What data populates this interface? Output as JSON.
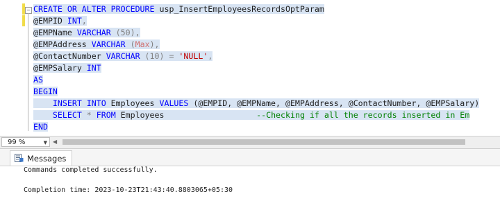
{
  "editor": {
    "lines": {
      "l1": [
        "CREATE OR ALTER PROCEDURE",
        " usp_InsertEmployeesRecordsOptParam"
      ],
      "l2": [
        "@EMPID ",
        "INT",
        ","
      ],
      "l3": [
        "@EMPName ",
        "VARCHAR",
        " (50),"
      ],
      "l4": [
        "@EMPAddress ",
        "VARCHAR",
        " (",
        "Max",
        "),"
      ],
      "l5": [
        "@ContactNumber ",
        "VARCHAR",
        " (10) = ",
        "'NULL'",
        ","
      ],
      "l6": [
        "@EMPSalary ",
        "INT"
      ],
      "l7": [
        "AS"
      ],
      "l8": [
        "BEGIN"
      ],
      "l9": [
        "INSERT INTO",
        " Employees ",
        "VALUES",
        " (@EMPID, @EMPName, @EMPAddress, @ContactNumber, @EMPSalary)"
      ],
      "l10": [
        "SELECT",
        " * ",
        "FROM",
        " Employees",
        "--Checking if all the records inserted in Em"
      ],
      "l11": [
        "END"
      ]
    }
  },
  "statusbar": {
    "zoom": "99 %",
    "zoom_arrow": "▼",
    "scroll_left": "◀"
  },
  "messages": {
    "tab_label": "Messages",
    "line1": "Commands completed successfully.",
    "line2": "Completion time: 2023-10-23T21:43:40.8803065+05:30"
  },
  "colors": {
    "keyword": "#0000ff",
    "string": "#c00000",
    "comment": "#008000",
    "selection": "#d8e4f3"
  }
}
